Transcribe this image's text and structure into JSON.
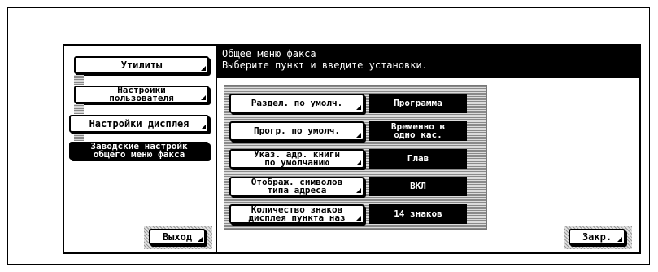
{
  "header": {
    "title": "Общее меню факса",
    "subtitle": "Выберите пункт и введите установки."
  },
  "sidebar": {
    "items": [
      {
        "label": "Утилиты"
      },
      {
        "label": "Настройки\nпользователя"
      },
      {
        "label": "Настройки дисплея"
      },
      {
        "label": "Заводские настрои́к\nобщего меню факса"
      }
    ],
    "exit_label": "Выход"
  },
  "settings": [
    {
      "label": "Раздел. по умолч.",
      "value": "Программа"
    },
    {
      "label": "Прогр. по умолч.",
      "value": "Временно в\nодно кас."
    },
    {
      "label": "Указ. адр. книги\nпо умолчанию",
      "value": "Глав"
    },
    {
      "label": "Отображ. символов\nтипа адреса",
      "value": "ВКЛ"
    },
    {
      "label": "Количество знаков\nдисплея пункта наз",
      "value": "14 знаков"
    }
  ],
  "footer": {
    "close_label": "Закр."
  }
}
